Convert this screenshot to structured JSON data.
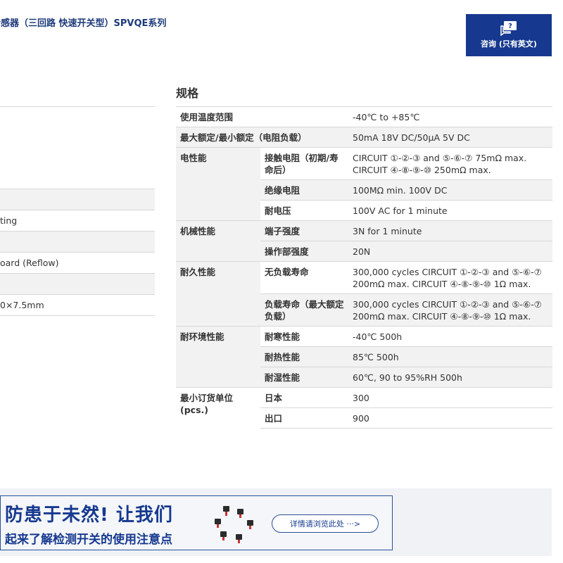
{
  "header": {
    "title": "传感器（三回路 快速开关型）SPVQE系列",
    "inquiry_label": "咨询 (只有英文)"
  },
  "left_list": [
    {
      "text": "",
      "gray": false
    },
    {
      "text": "",
      "gray": false
    },
    {
      "text": "",
      "gray": false
    },
    {
      "text": "",
      "gray": false
    },
    {
      "text": "",
      "gray": true
    },
    {
      "text": "ting",
      "gray": false
    },
    {
      "text": "",
      "gray": true
    },
    {
      "text": "oard (Reflow)",
      "gray": false
    },
    {
      "text": "",
      "gray": true
    },
    {
      "text": "0×7.5mm",
      "gray": false
    }
  ],
  "spec": {
    "heading": "规格",
    "rows": [
      {
        "c1": "使用温度范围",
        "c2": "",
        "value": "-40℃ to +85℃"
      },
      {
        "c1": "最大额定/最小额定（电阻负载）",
        "c2": "",
        "value": "50mA 18V DC/50μA 5V DC"
      },
      {
        "c1": "电性能",
        "c2": "接触电阻（初期/寿命后）",
        "value": "CIRCUIT ①-②-③ and ⑤-⑥-⑦ 75mΩ max. CIRCUIT ④-⑧-⑨-⑩ 250mΩ max."
      },
      {
        "c1": "",
        "c2": "绝缘电阻",
        "value": "100MΩ min. 100V DC"
      },
      {
        "c1": "",
        "c2": "耐电压",
        "value": "100V AC for 1 minute"
      },
      {
        "c1": "机械性能",
        "c2": "端子强度",
        "value": "3N for 1 minute"
      },
      {
        "c1": "",
        "c2": "操作部强度",
        "value": "20N"
      },
      {
        "c1": "耐久性能",
        "c2": "无负载寿命",
        "value": "300,000 cycles CIRCUIT ①-②-③ and ⑤-⑥-⑦ 200mΩ max. CIRCUIT ④-⑧-⑨-⑩ 1Ω max."
      },
      {
        "c1": "",
        "c2": "负载寿命（最大额定负载）",
        "value": "300,000 cycles CIRCUIT ①-②-③ and ⑤-⑥-⑦ 200mΩ max. CIRCUIT ④-⑧-⑨-⑩ 1Ω max."
      },
      {
        "c1": "耐环境性能",
        "c2": "耐寒性能",
        "value": "-40℃ 500h"
      },
      {
        "c1": "",
        "c2": "耐热性能",
        "value": "85℃ 500h"
      },
      {
        "c1": "",
        "c2": "耐湿性能",
        "value": "60℃, 90 to 95%RH 500h"
      },
      {
        "c1": "最小订货单位(pcs.)",
        "c2": "日本",
        "value": "300"
      },
      {
        "c1": "",
        "c2": "出口",
        "value": "900"
      }
    ]
  },
  "banner": {
    "line1": "防患于未然! 让我们",
    "line2": "起来了解检测开关的使用注意点",
    "button_label": "详情请浏览此处 ···>"
  }
}
